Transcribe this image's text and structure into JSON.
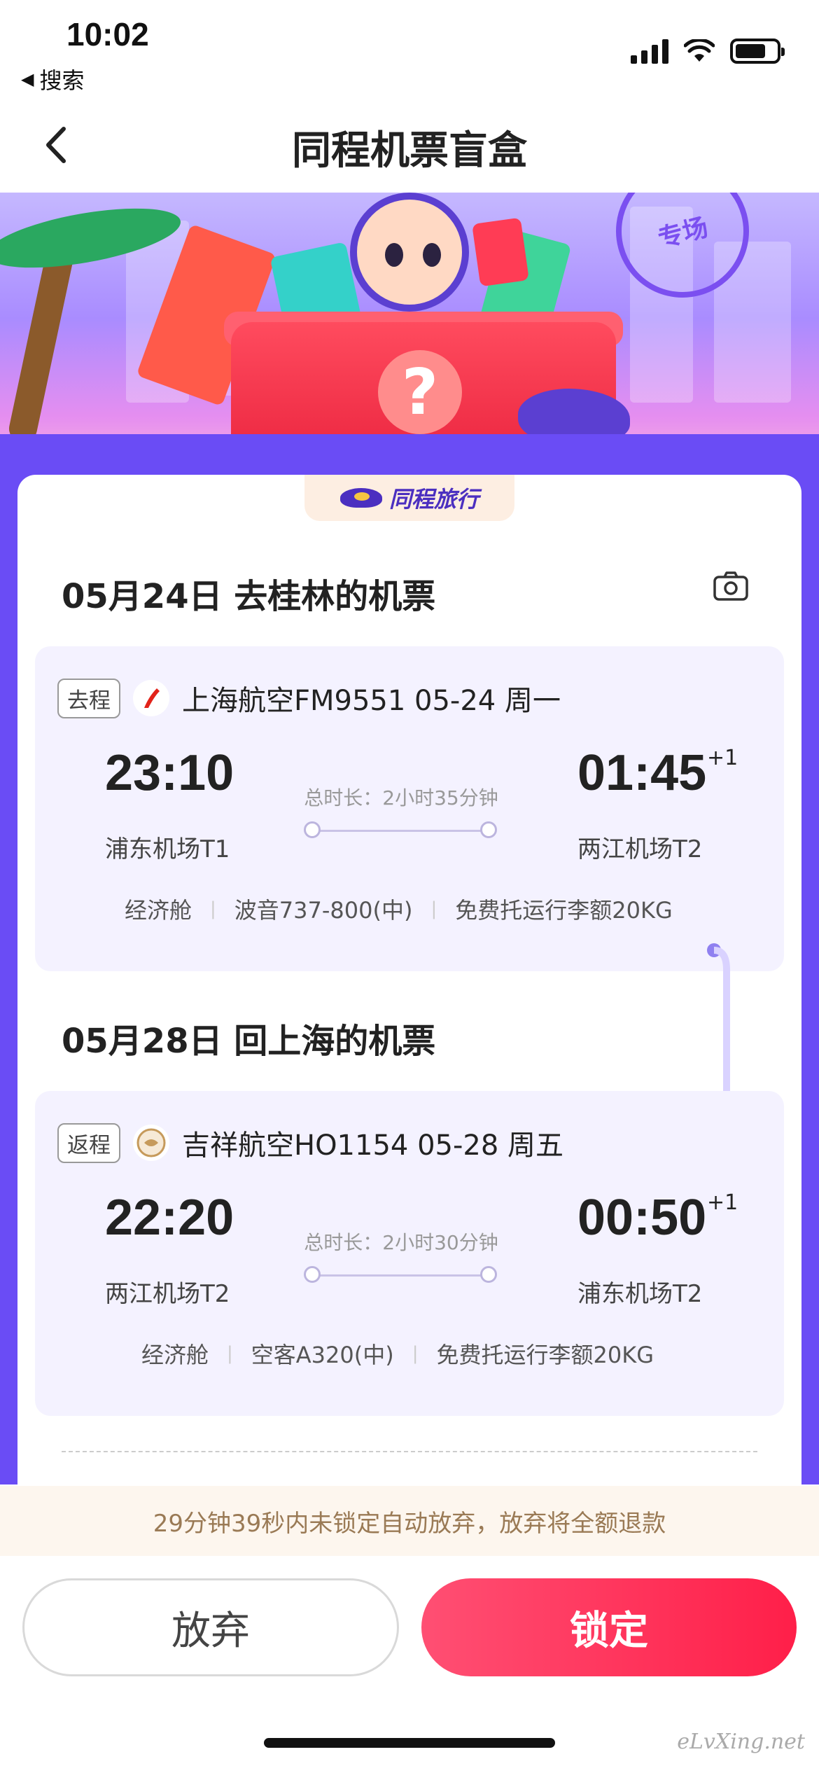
{
  "status_bar": {
    "time": "10:02",
    "back_app_label": "搜索"
  },
  "nav": {
    "title": "同程机票盲盒"
  },
  "banner": {
    "stamp_text": "专场"
  },
  "brand": {
    "name": "同程旅行"
  },
  "outbound": {
    "section_title": "05月24日 去桂林的机票",
    "badge": "去程",
    "airline_flight": "上海航空FM9551  05-24 周一",
    "dep_time": "23:10",
    "arr_time": "01:45",
    "arr_day_offset": "+1",
    "dep_airport": "浦东机场T1",
    "arr_airport": "两江机场T2",
    "duration": "总时长：2小时35分钟",
    "cabin": "经济舱",
    "aircraft": "波音737-800(中)",
    "baggage": "免费托运行李额20KG"
  },
  "return": {
    "section_title": "05月28日 回上海的机票",
    "badge": "返程",
    "airline_flight": "吉祥航空HO1154  05-28 周五",
    "dep_time": "22:20",
    "arr_time": "00:50",
    "arr_day_offset": "+1",
    "dep_airport": "两江机场T2",
    "arr_airport": "浦东机场T2",
    "duration": "总时长：2小时30分钟",
    "cabin": "经济舱",
    "aircraft": "空客A320(中)",
    "baggage": "免费托运行李额20KG"
  },
  "notice": "29分钟39秒内未锁定自动放弃，放弃将全额退款",
  "actions": {
    "abandon_label": "放弃",
    "lock_label": "锁定"
  },
  "watermark": "eLvXing.net",
  "colors": {
    "accent": "#ff1f49",
    "brand_purple": "#6a4cf5",
    "notice_text": "#9a7a55"
  }
}
